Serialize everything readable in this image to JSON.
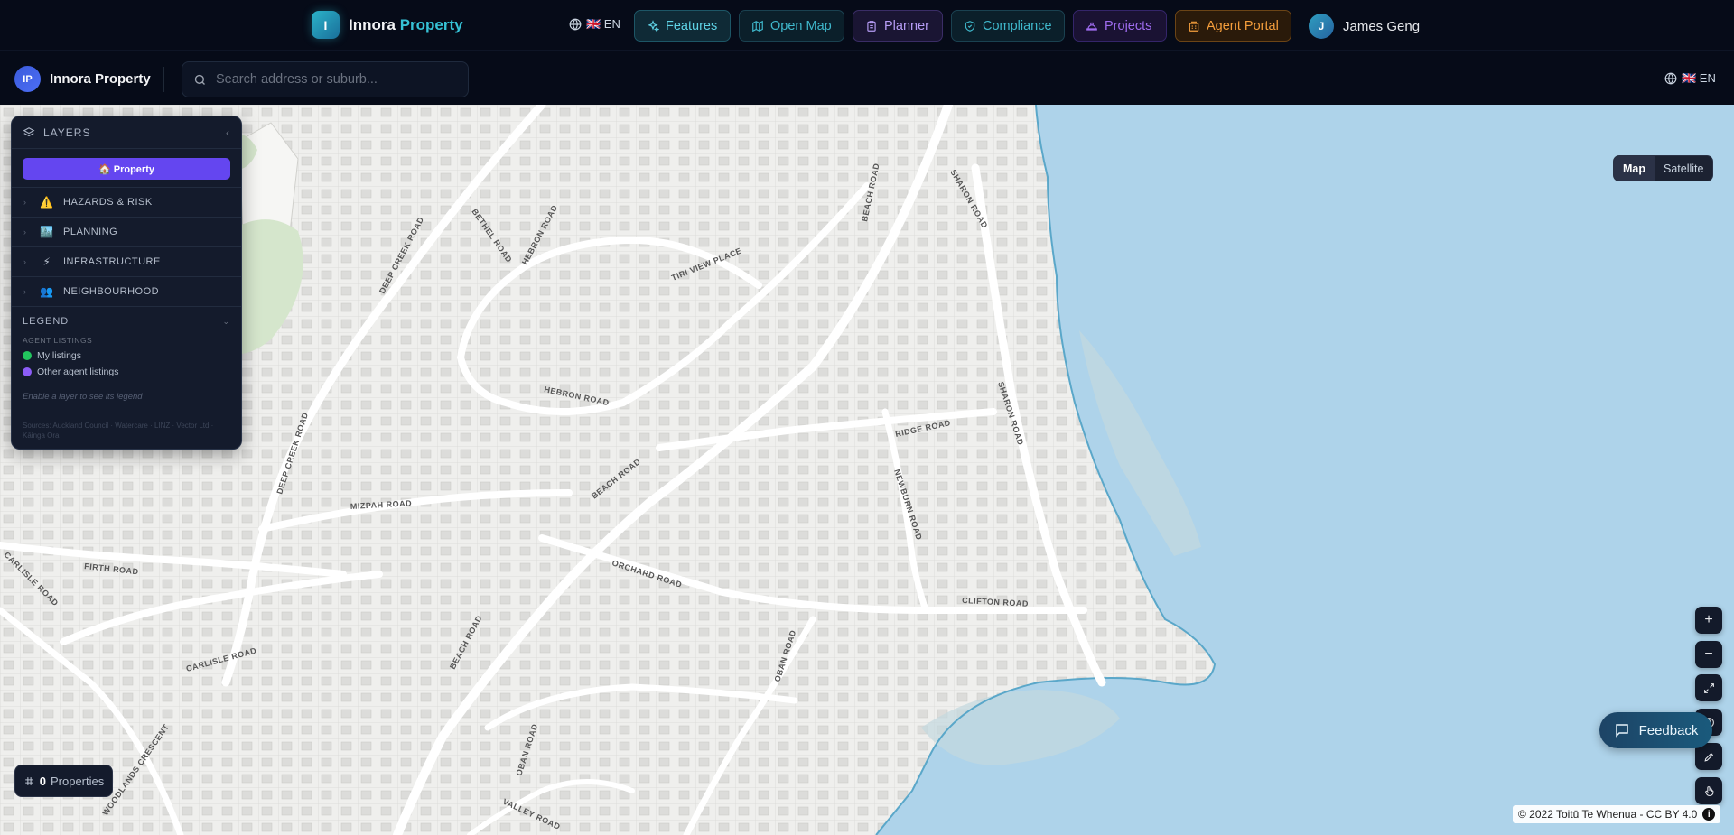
{
  "topnav": {
    "brand_logo": "I",
    "brand_first": "Innora",
    "brand_second": "Property",
    "lang": "🇬🇧 EN",
    "features": "Features",
    "open_map": "Open Map",
    "planner": "Planner",
    "compliance": "Compliance",
    "projects": "Projects",
    "agent_portal": "Agent Portal",
    "user_initial": "J",
    "user_name": "James Geng"
  },
  "subbar": {
    "logo": "IP",
    "name": "Innora Property",
    "search_placeholder": "Search address or suburb...",
    "lang": "🇬🇧 EN"
  },
  "layers": {
    "title": "LAYERS",
    "property_button": "🏠 Property",
    "groups": [
      {
        "emoji": "⚠️",
        "label": "HAZARDS & RISK"
      },
      {
        "emoji": "🏙️",
        "label": "PLANNING"
      },
      {
        "emoji": "⚡",
        "label": "INFRASTRUCTURE"
      },
      {
        "emoji": "👥",
        "label": "NEIGHBOURHOOD"
      }
    ],
    "legend": {
      "title": "LEGEND",
      "subtitle": "AGENT LISTINGS",
      "items": [
        {
          "label": "My listings",
          "color": "#22c55e"
        },
        {
          "label": "Other agent listings",
          "color": "#8b5cf6"
        }
      ],
      "note": "Enable a layer to see its legend",
      "sources": "Sources: Auckland Council · Watercare · LINZ · Vector Ltd · Kāinga Ora"
    }
  },
  "map": {
    "type_map": "Map",
    "type_satellite": "Satellite",
    "zoom_in": "+",
    "zoom_out": "−",
    "feedback": "Feedback",
    "properties_count": "0",
    "properties_label": "Properties",
    "attribution": "© 2022 Toitū Te Whenua - CC BY 4.0",
    "roads": [
      "DEEP CREEK ROAD",
      "BETHEL ROAD",
      "HEBRON ROAD",
      "TIRI VIEW PLACE",
      "BEACH ROAD",
      "SHARON ROAD",
      "RIDGE ROAD",
      "NEWBURN ROAD",
      "MIZPAH ROAD",
      "FIRTH ROAD",
      "CARLISLE ROAD",
      "ORCHARD ROAD",
      "CLIFTON ROAD",
      "OBAN ROAD",
      "VALLEY ROAD",
      "WOODLANDS CRESCENT"
    ],
    "colors": {
      "land": "#f2f2f0",
      "water": "#aed3ea",
      "road": "#ffffff",
      "park": "#d5e6cc"
    }
  }
}
